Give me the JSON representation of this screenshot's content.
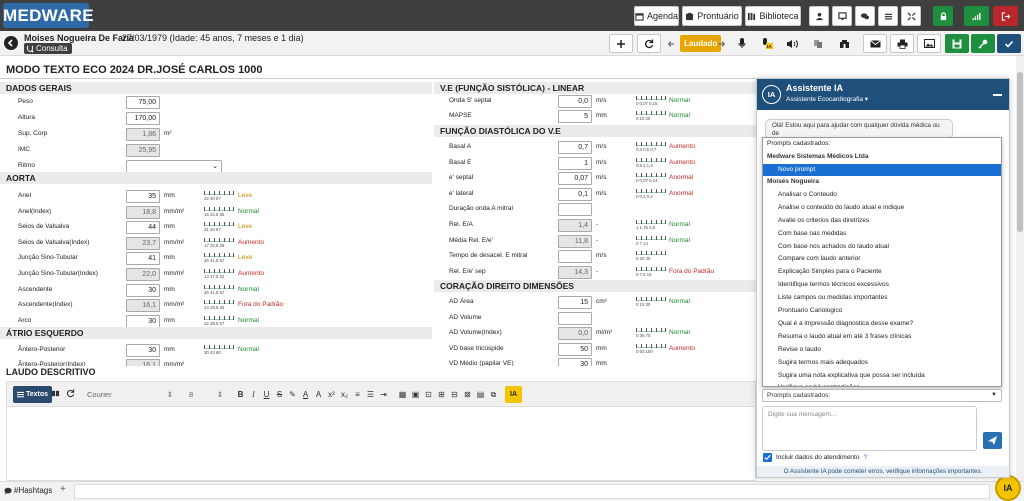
{
  "app": {
    "logo": "MEDWARE"
  },
  "topbar": {
    "agenda": "Agenda",
    "prontuario": "Prontuário",
    "biblioteca": "Biblioteca"
  },
  "patient": {
    "name": "Moises Nogueira De Faria",
    "dob": "27/03/1979 (Idade: 45 anos, 7 meses e 1 dia)",
    "consulta": "Consulta"
  },
  "toolbar": {
    "status": "Laudado"
  },
  "doc": {
    "title": "MODO TEXTO ECO 2024 DR.JOSÉ CARLOS 1000"
  },
  "sections": {
    "dados": "DADOS GERAIS",
    "aorta": "AORTA",
    "atrio": "ÁTRIO ESQUERDO",
    "ve": "V.E (FUNÇÃO SISTÓLICA) - LINEAR",
    "diast": "FUNÇÃO DIASTÓLICA DO V.E",
    "direito": "CORAÇÃO DIREITO DIMENSÕES"
  },
  "dados": [
    {
      "label": "Peso",
      "value": "75,00",
      "unit": ""
    },
    {
      "label": "Altura",
      "value": "170,00",
      "unit": ""
    },
    {
      "label": "Sup. Corp",
      "value": "1,86",
      "unit": "m²"
    },
    {
      "label": "IMC",
      "value": "25,95",
      "unit": ""
    },
    {
      "label": "Ritmo",
      "value": "",
      "unit": ""
    }
  ],
  "aorta": [
    {
      "label": "Anel",
      "value": "35",
      "unit": "mm",
      "scale": "22  40  57",
      "status": "Leve"
    },
    {
      "label": "Anel(Index)",
      "value": "18,8",
      "unit": "mm/m²",
      "scale": "15  22,5  36",
      "status": "Normal"
    },
    {
      "label": "Seios de Valsalva",
      "value": "44",
      "unit": "mm",
      "scale": "31  44  57",
      "status": "Leve"
    },
    {
      "label": "Seios de Valsalva(Index)",
      "value": "23,7",
      "unit": "mm/m²",
      "scale": "17  22,5  28",
      "status": "Aumento"
    },
    {
      "label": "Junção Sino-Tubular",
      "value": "41",
      "unit": "mm",
      "scale": "26  41,5  57",
      "status": "Leve"
    },
    {
      "label": "Junção Sino-Tubular(Index)",
      "value": "22,0",
      "unit": "mm/m²",
      "scale": "13  17,5  22",
      "status": "Aumento"
    },
    {
      "label": "Ascendente",
      "value": "30",
      "unit": "mm",
      "scale": "26  41,5  57",
      "status": "Normal"
    },
    {
      "label": "Ascendente(Index)",
      "value": "16,1",
      "unit": "mm/m²",
      "scale": "14  19,5  25",
      "status": "Fora do Padrão"
    },
    {
      "label": "Arco",
      "value": "30",
      "unit": "mm",
      "scale": "22  39,5  57",
      "status": "Normal"
    }
  ],
  "atrio": [
    {
      "label": "Ântero-Posterior",
      "value": "30",
      "unit": "mm",
      "scale": "30  42  60",
      "status": "Normal"
    },
    {
      "label": "Ântero-Posterior(Index)",
      "value": "16,1",
      "unit": "mm/m²",
      "scale": "",
      "status": ""
    }
  ],
  "ve": [
    {
      "label": "Onda S' septal",
      "value": "0,0",
      "unit": "m/s",
      "scale": "0  0,07  0,15",
      "status": "Normal"
    },
    {
      "label": "MAPSE",
      "value": "5",
      "unit": "mm",
      "scale": "0  10  20",
      "status": "Normal"
    }
  ],
  "diast": [
    {
      "label": "Basal A",
      "value": "0,7",
      "unit": "m/s",
      "scale": "0,3  0,5  0,7",
      "status": "Aumento"
    },
    {
      "label": "Basal E",
      "value": "1",
      "unit": "m/s",
      "scale": "0,6  1  1,4",
      "status": "Aumento"
    },
    {
      "label": "e' septal",
      "value": "0,07",
      "unit": "m/s",
      "scale": "0  0,07  0,14",
      "status": "Anormal"
    },
    {
      "label": "e' lateral",
      "value": "0,1",
      "unit": "m/s",
      "scale": "0  0,1  0,2",
      "status": "Anormal"
    },
    {
      "label": "Duração onda A mitral",
      "value": "",
      "unit": "",
      "scale": "",
      "status": ""
    },
    {
      "label": "Rel. E/A",
      "value": "1,4",
      "unit": "-",
      "scale": "1  1,75  2,5",
      "status": "Normal"
    },
    {
      "label": "Média Rel. E/e'",
      "value": "11,8",
      "unit": "-",
      "scale": "0  7  14",
      "status": "Normal"
    },
    {
      "label": "Tempo de desacel. E mitral",
      "value": "",
      "unit": "m/s",
      "scale": "0  26  40",
      "status": ""
    },
    {
      "label": "Rel. E/e' sep",
      "value": "14,3",
      "unit": "-",
      "scale": "0  7,5  15",
      "status": "Fora do Padrão"
    }
  ],
  "direito": [
    {
      "label": "AD Área",
      "value": "15",
      "unit": "cm²",
      "scale": "0  15  30",
      "status": "Normal"
    },
    {
      "label": "AD Volume",
      "value": "",
      "unit": "",
      "scale": "",
      "status": ""
    },
    {
      "label": "AD Volume(Index)",
      "value": "0,0",
      "unit": "ml/m²",
      "scale": "0  35  70",
      "status": "Normal"
    },
    {
      "label": "VD base tricúspide",
      "value": "50",
      "unit": "mm",
      "scale": "0  60  100",
      "status": "Aumento"
    },
    {
      "label": "VD Médio (papilar VE)",
      "value": "30",
      "unit": "mm",
      "scale": "",
      "status": ""
    }
  ],
  "laudo": {
    "title": "LAUDO DESCRITIVO",
    "textos_btn": "Textos",
    "font": "Courier",
    "size": "8",
    "ia_btn": "IA"
  },
  "bottom": {
    "hashtags": "#Hashtags",
    "plus": "+",
    "ia_fab": "IA"
  },
  "ia": {
    "avatar": "IA",
    "title": "Assistente IA",
    "subtitle": "Assistente Ecocardiografia ▾",
    "greeting": "Olá! Estou aqui para ajudar com qualquer dúvida médica ou de",
    "dropdown_header": "Prompts cadastrados:",
    "groups": [
      {
        "name": "Medware Sistemas Médicos Ltda",
        "items": [
          "Novo prompt"
        ]
      },
      {
        "name": "Moisés Nogueira",
        "items": [
          "Analisar o Conteudo",
          "Analise o conteúdo do laudo atual e indique",
          "Avalie os criterios das diretrizes",
          "Com base nas medidas",
          "Com base nos achados do laudo atual",
          "Compare com laudo anterior",
          "Explicação Simples para o Paciente",
          "Identifique termos técnicos excessivos",
          "Liste campos ou medidas importantes",
          "Prontuario Cariologico",
          "Qual é a impressão diagnostica desse exame?",
          "Resuma o laudo atual em até 3 frases clínicas",
          "Revise o laudo",
          "Sugira termos mais adequados",
          "Sugira uma nota explicativa que possa ser incluída",
          "Verifique se há contradições"
        ]
      }
    ],
    "selected": "Novo prompt",
    "select_closed": "Prompts cadastrados:",
    "message_placeholder": "Digite sua mensagem...",
    "include_label": "Incluir dados do atendimento",
    "include_help": "?",
    "footer": "O Assistente IA pode cometer erros, verifique informações importantes."
  },
  "colors": {
    "brand": "#2e6aa8",
    "ia_header": "#1f4f7b",
    "accent_yellow": "#f5c400",
    "normal": "#1a8a2a",
    "alert": "#c62828",
    "mild": "#c08a00"
  }
}
